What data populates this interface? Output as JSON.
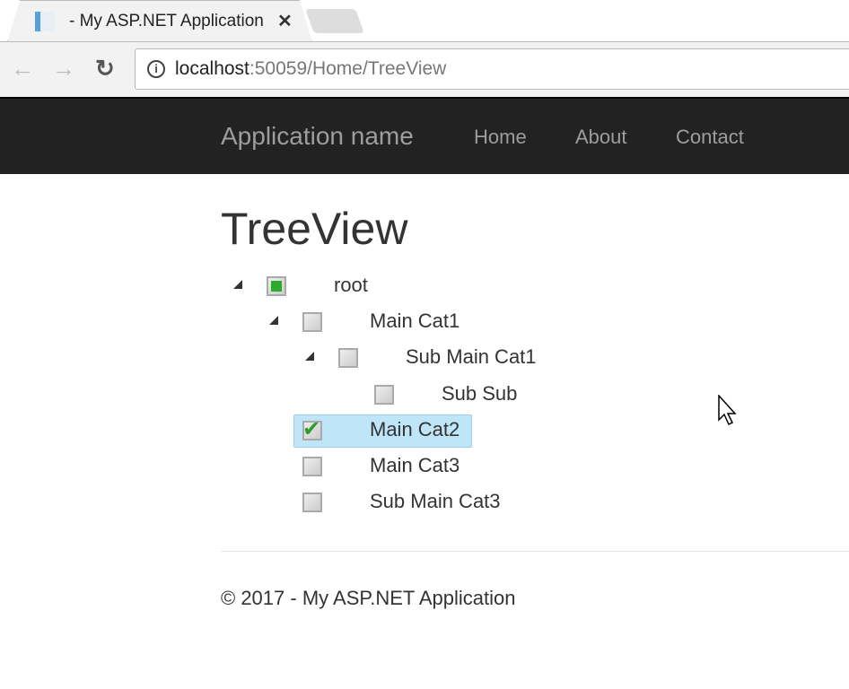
{
  "browser": {
    "tab_title": "- My ASP.NET Application",
    "url_host": "localhost",
    "url_rest": ":50059/Home/TreeView"
  },
  "navbar": {
    "brand": "Application name",
    "links": [
      "Home",
      "About",
      "Contact"
    ]
  },
  "page": {
    "title": "TreeView",
    "footer": "© 2017 - My ASP.NET Application"
  },
  "tree": [
    {
      "label": "root",
      "level": 0,
      "expanded": true,
      "state": "partial"
    },
    {
      "label": "Main Cat1",
      "level": 1,
      "expanded": true,
      "state": "unchecked"
    },
    {
      "label": "Sub Main Cat1",
      "level": 2,
      "expanded": true,
      "state": "unchecked"
    },
    {
      "label": "Sub Sub",
      "level": 3,
      "expanded": null,
      "state": "unchecked"
    },
    {
      "label": "Main Cat2",
      "level": 1,
      "expanded": null,
      "state": "checked",
      "selected": true
    },
    {
      "label": "Main Cat3",
      "level": 1,
      "expanded": null,
      "state": "unchecked"
    },
    {
      "label": "Sub Main Cat3",
      "level": 1,
      "expanded": null,
      "state": "unchecked"
    }
  ]
}
